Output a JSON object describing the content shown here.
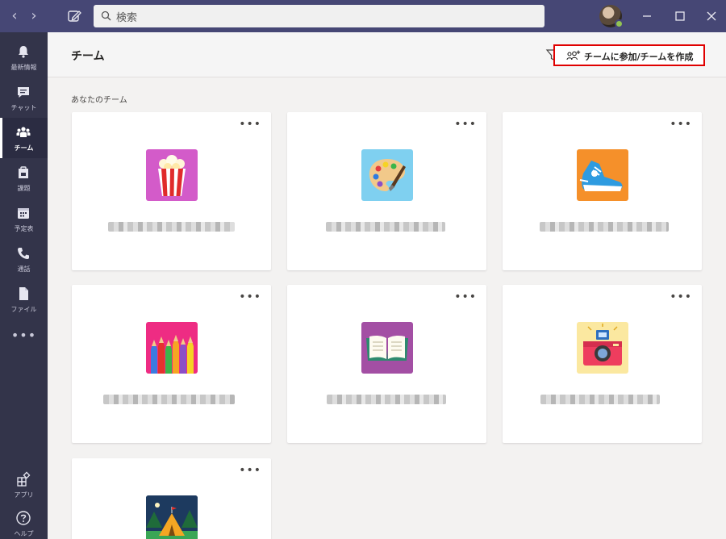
{
  "search": {
    "placeholder": "検索"
  },
  "rail": {
    "items": [
      {
        "label": "最新情報",
        "icon": "bell-icon"
      },
      {
        "label": "チャット",
        "icon": "chat-icon"
      },
      {
        "label": "チーム",
        "icon": "teams-icon",
        "active": true
      },
      {
        "label": "課題",
        "icon": "assignments-icon"
      },
      {
        "label": "予定表",
        "icon": "calendar-icon"
      },
      {
        "label": "通話",
        "icon": "phone-icon"
      },
      {
        "label": "ファイル",
        "icon": "file-icon"
      }
    ],
    "more": "•••",
    "apps_label": "アプリ",
    "help_label": "ヘルプ"
  },
  "header": {
    "title": "チーム",
    "join_label": "チームに参加/チームを作成"
  },
  "section_label": "あなたのチーム",
  "teams": [
    {
      "icon": "popcorn-icon",
      "tile_color": "#d35bc9"
    },
    {
      "icon": "palette-icon",
      "tile_color": "#7fd0f0"
    },
    {
      "icon": "sneaker-icon",
      "tile_color": "#f5902a"
    },
    {
      "icon": "pencils-icon",
      "tile_color": "#ee2c83"
    },
    {
      "icon": "book-icon",
      "tile_color": "#a34fa4"
    },
    {
      "icon": "camera-icon",
      "tile_color": "#fbe8a0"
    },
    {
      "icon": "tent-icon",
      "tile_color": "#1d3a5f"
    }
  ],
  "card_more": "•••",
  "colors": {
    "titlebar": "#464775",
    "rail": "#33344a",
    "highlight": "#e00000"
  }
}
